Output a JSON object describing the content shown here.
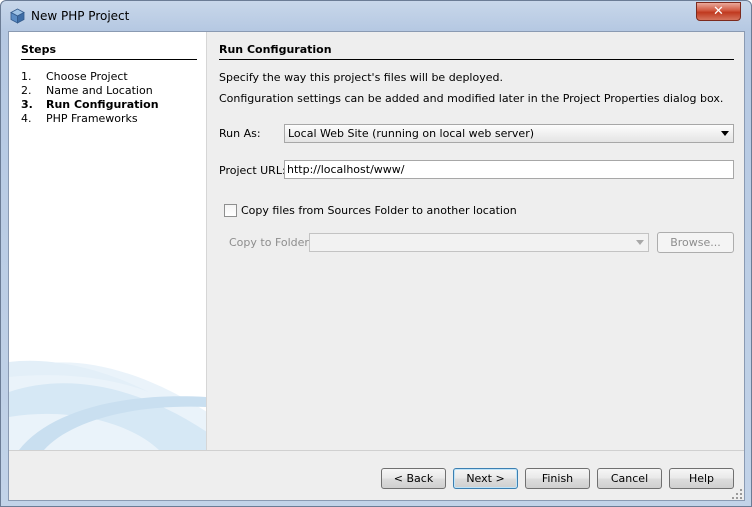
{
  "window": {
    "title": "New PHP Project",
    "app_icon": "cube-icon",
    "close_glyph": "✕"
  },
  "steps": {
    "title": "Steps",
    "items": [
      {
        "num": "1.",
        "label": "Choose Project"
      },
      {
        "num": "2.",
        "label": "Name and Location"
      },
      {
        "num": "3.",
        "label": "Run Configuration"
      },
      {
        "num": "4.",
        "label": "PHP Frameworks"
      }
    ],
    "current_index": 2
  },
  "panel": {
    "title": "Run Configuration",
    "desc1": "Specify the way this project's files will be deployed.",
    "desc2": "Configuration settings can be added and modified later in the Project Properties dialog box.",
    "run_as_label": "Run As:",
    "run_as_value": "Local Web Site (running on local web server)",
    "project_url_label": "Project URL:",
    "project_url_value": "http://localhost/www/",
    "copy_checkbox_label": "Copy files from Sources Folder to another location",
    "copy_checked": false,
    "copy_to_folder_label": "Copy to Folder:",
    "copy_to_folder_value": "",
    "browse_label": "Browse..."
  },
  "buttons": {
    "back": "< Back",
    "next": "Next >",
    "finish": "Finish",
    "cancel": "Cancel",
    "help": "Help"
  },
  "colors": {
    "title_bar": "#b5c8e2",
    "close": "#c0391f",
    "dialog_bg": "#eeeeee",
    "steps_bg": "#ffffff",
    "swoosh": "#c9dff0"
  }
}
